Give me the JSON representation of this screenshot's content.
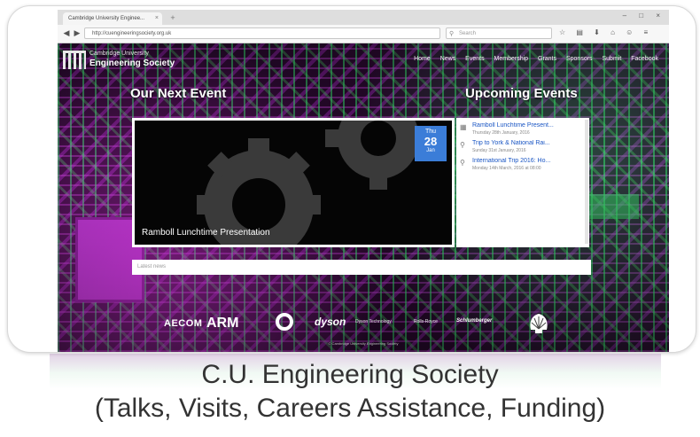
{
  "browser": {
    "tab_title": "Cambridge University Enginee...",
    "tab_close_glyph": "×",
    "new_tab_glyph": "+",
    "url": "http://cuengineeringsociety.org.uk",
    "search_placeholder": "Search",
    "search_icon": "search-icon",
    "back_glyph": "◀",
    "forward_glyph": "▶",
    "toolbar_glyphs": "☆ ▤ ⬇ ⌂ ☺ ≡",
    "window_controls": "– □ ×"
  },
  "site": {
    "logo_line1": "Cambridge University",
    "logo_line2": "Engineering Society",
    "menu": [
      "Home",
      "News",
      "Events",
      "Membership",
      "Grants",
      "Sponsors",
      "Submit",
      "Facebook"
    ],
    "next_event_heading": "Our Next Event",
    "upcoming_heading": "Upcoming Events",
    "featured": {
      "title": "Ramboll Lunchtime Presentation",
      "day": "Thu",
      "date": "28",
      "month": "Jan"
    },
    "events": [
      {
        "title": "Ramboll Lunchtime Present...",
        "date": "Thursday 28th January, 2016",
        "icon": "building-icon"
      },
      {
        "title": "Trip to York & National Rai...",
        "date": "Sunday 31st January, 2016",
        "icon": "pin-icon"
      },
      {
        "title": "International Trip 2016: Ho...",
        "date": "Monday 14th March, 2016 at 08:00",
        "icon": "pin-icon"
      }
    ],
    "news_label": "Latest news",
    "sponsors": {
      "aecom": "AECOM",
      "arm": "ARM",
      "dyson": "dyson",
      "dyson_sub": "Dyson Technology",
      "rolls_royce": "Rolls-Royce",
      "schlumberger": "Schlumberger"
    },
    "copyright": "© Cambridge University Engineering Society"
  },
  "caption": {
    "line1": "C.U. Engineering Society",
    "line2": "(Talks, Visits, Careers Assistance, Funding)"
  }
}
